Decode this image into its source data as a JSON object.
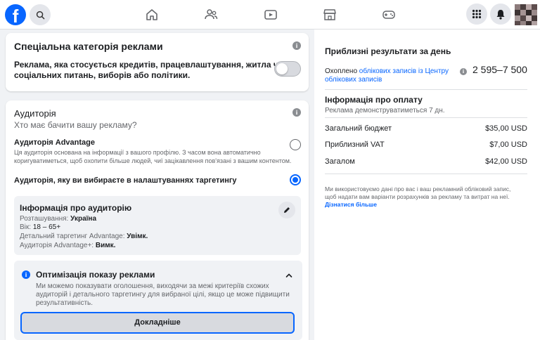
{
  "topbar": {
    "logo_letter": "f",
    "nav_icons": [
      "home-icon",
      "friends-icon",
      "video-icon",
      "marketplace-icon",
      "gaming-icon"
    ],
    "right_icons": [
      "menu-grid-icon",
      "notifications-bell-icon",
      "profile-avatar"
    ]
  },
  "special_category": {
    "title": "Спеціальна категорія реклами",
    "description_line1": "Реклама, яка стосується кредитів, працевлаштування, житла чи",
    "description_line2": "соціальних питань, виборів або політики.",
    "toggle_on": false
  },
  "audience": {
    "title": "Аудиторія",
    "subtitle": "Хто має бачити вашу рекламу?",
    "option_advantage_title": "Аудиторія Advantage",
    "option_advantage_desc_line1": "Ця аудиторія основана на інформації з вашого профілю. З часом вона автоматично",
    "option_advantage_desc_line2": "коригуватиметься, щоб охопити більше людей, чиї зацікавлення пов'язані з вашим контентом.",
    "option_custom_title": "Аудиторія, яку ви вибираєте в налаштуваннях таргетингу",
    "selected_option": "custom"
  },
  "audience_info": {
    "title": "Інформація про аудиторію",
    "location_label": "Розташування: ",
    "location_value": "Україна",
    "age_label": "Вік: ",
    "age_value": "18 – 65+",
    "detailed_label": "Детальний таргетинг Advantage: ",
    "detailed_value": "Увімк.",
    "advplus_label": "Аудиторія Advantage+: ",
    "advplus_value": "Вимк."
  },
  "optimization": {
    "title": "Оптимізація показу реклами",
    "desc_line1": "Ми можемо показувати оголошення, виходячи за межі критеріїв схожих",
    "desc_line2": "аудиторій і детального таргетингу для вибраної цілі, якщо це може підвищити",
    "desc_line3": "результативність.",
    "button_label": "Докладніше"
  },
  "daily_results": {
    "title": "Приблизні результати за день",
    "reach_prefix": "Охоплено ",
    "reach_link_line1": "облікових записів із Центру",
    "reach_link_line2": "облікових записів",
    "reach_value": "2 595–7 500"
  },
  "payment": {
    "title": "Інформація про оплату",
    "subtitle": "Реклама демонструватиметься 7 дн.",
    "rows": [
      {
        "label": "Загальний бюджет",
        "value": "$35,00 USD"
      },
      {
        "label": "Приблизний VAT",
        "value": "$7,00 USD"
      },
      {
        "label": "Загалом",
        "value": "$42,00 USD"
      }
    ],
    "disclaimer_line1": "Ми використовуємо дані про вас і ваш рекламний обліковий запис,",
    "disclaimer_line2": "щоб надати вам варіанти розрахунків за рекламу та витрат на неї.",
    "learn_more": "Дізнатися більше"
  },
  "colors": {
    "accent": "#0866ff",
    "background": "#f0f2f5",
    "text_primary": "#1c1e21",
    "text_secondary": "#65676b"
  }
}
